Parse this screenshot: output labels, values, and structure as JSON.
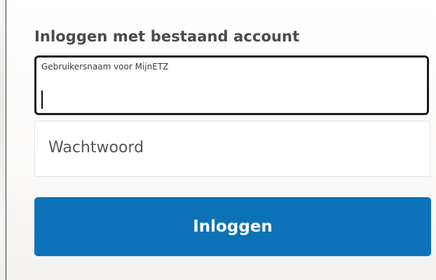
{
  "form": {
    "heading": "Inloggen met bestaand account",
    "username": {
      "label": "Gebruikersnaam voor MijnETZ",
      "value": ""
    },
    "password": {
      "placeholder": "Wachtwoord",
      "value": ""
    },
    "submit_label": "Inloggen"
  },
  "colors": {
    "button_bg": "#0c72b8",
    "button_text": "#ffffff",
    "heading": "#4a4a4a",
    "focus_border": "#1c1c1c"
  }
}
